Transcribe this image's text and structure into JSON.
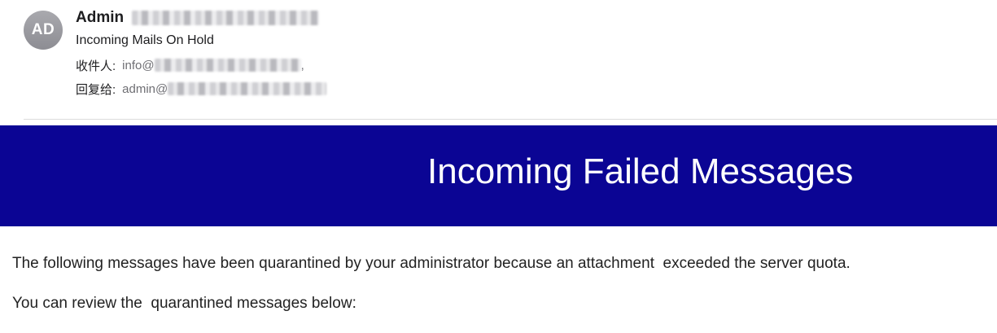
{
  "header": {
    "avatar_initials": "AD",
    "sender_name": "Admin",
    "subject": "Incoming Mails On Hold",
    "to_label": "收件人:",
    "to_value": "info@",
    "to_suffix": ",",
    "reply_label": "回复给:",
    "reply_value": "admin@"
  },
  "banner": {
    "title": "Incoming Failed Messages",
    "background_color": "#0b0594"
  },
  "body": {
    "paragraph_1": "The following messages have been quarantined by your administrator because an attachment  exceeded the server quota.",
    "paragraph_2": "You can review the  quarantined messages below:"
  }
}
